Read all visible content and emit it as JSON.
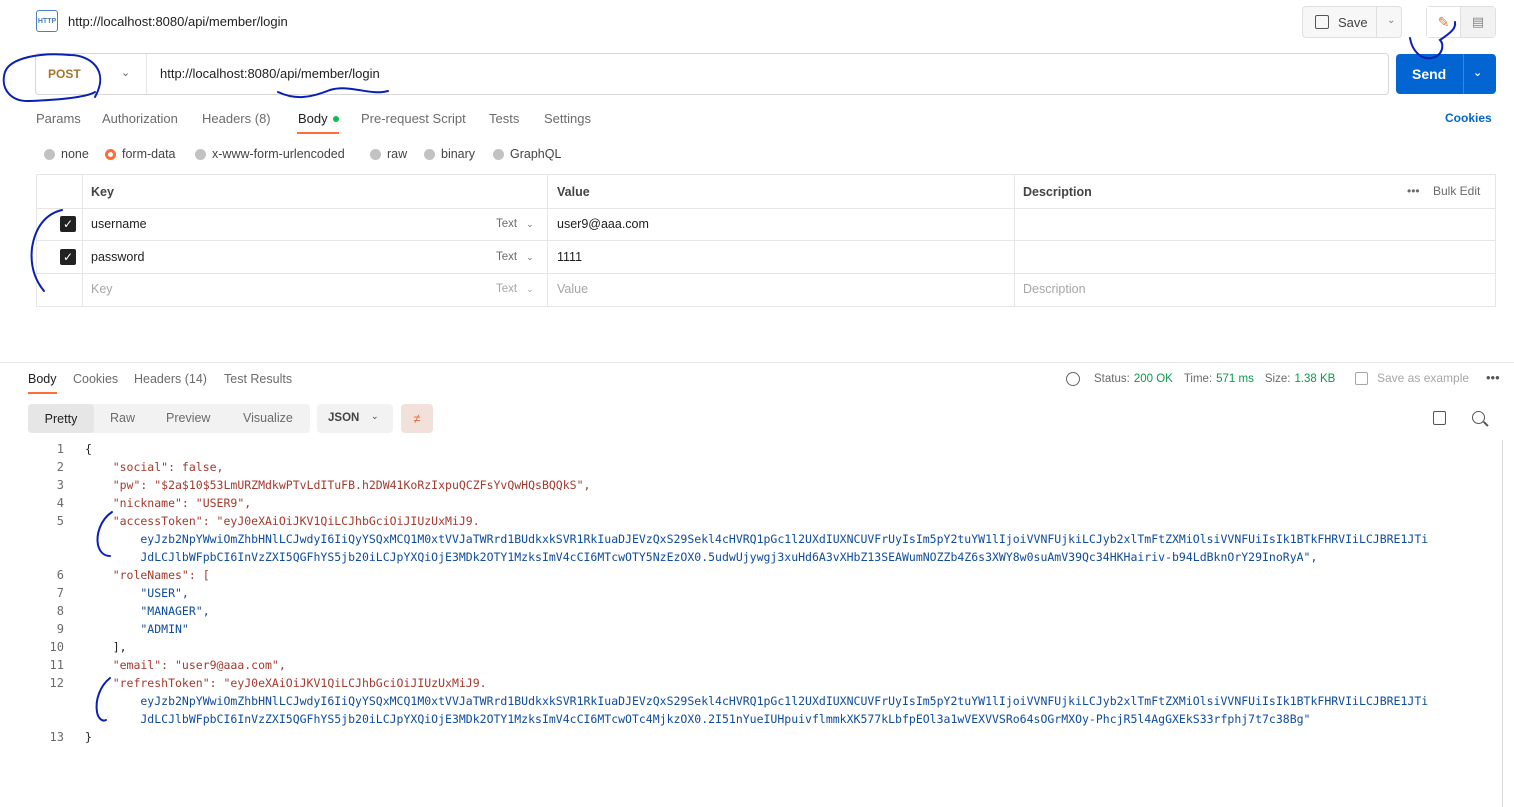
{
  "header": {
    "title": "http://localhost:8080/api/member/login",
    "http_icon_text": "HTTP",
    "save_label": "Save"
  },
  "request": {
    "method": "POST",
    "url": "http://localhost:8080/api/member/login",
    "send_label": "Send"
  },
  "tabs": [
    {
      "label": "Params"
    },
    {
      "label": "Authorization"
    },
    {
      "label": "Headers (8)"
    },
    {
      "label": "Body"
    },
    {
      "label": "Pre-request Script"
    },
    {
      "label": "Tests"
    },
    {
      "label": "Settings"
    }
  ],
  "cookies_label": "Cookies",
  "body_types": [
    {
      "label": "none"
    },
    {
      "label": "form-data"
    },
    {
      "label": "x-www-form-urlencoded"
    },
    {
      "label": "raw"
    },
    {
      "label": "binary"
    },
    {
      "label": "GraphQL"
    }
  ],
  "params_table": {
    "headers": {
      "key": "Key",
      "value": "Value",
      "description": "Description",
      "bulk_edit": "Bulk Edit"
    },
    "rows": [
      {
        "key": "username",
        "type": "Text",
        "value": "user9@aaa.com",
        "description": ""
      },
      {
        "key": "password",
        "type": "Text",
        "value": "1111",
        "description": ""
      }
    ],
    "placeholder": {
      "key": "Key",
      "type": "Text",
      "value": "Value",
      "description": "Description"
    }
  },
  "response": {
    "tabs": [
      {
        "label": "Body"
      },
      {
        "label": "Cookies"
      },
      {
        "label": "Headers (14)"
      },
      {
        "label": "Test Results"
      }
    ],
    "status_label": "Status:",
    "status_value": "200 OK",
    "time_label": "Time:",
    "time_value": "571 ms",
    "size_label": "Size:",
    "size_value": "1.38 KB",
    "save_example": "Save as example",
    "view_modes": [
      {
        "label": "Pretty"
      },
      {
        "label": "Raw"
      },
      {
        "label": "Preview"
      },
      {
        "label": "Visualize"
      }
    ],
    "format": "JSON"
  },
  "code": {
    "line_numbers": [
      "1",
      "2",
      "3",
      "4",
      "5",
      "6",
      "7",
      "8",
      "9",
      "10",
      "11",
      "12",
      "13"
    ],
    "lines": [
      "{",
      "    \"social\": false,",
      "    \"pw\": \"$2a$10$53LmURZMdkwPTvLdITuFB.h2DW41KoRzIxpuQCZFsYvQwHQsBQQkS\",",
      "    \"nickname\": \"USER9\",",
      "    \"accessToken\": \"eyJ0eXAiOiJKV1QiLCJhbGciOiJIUzUxMiJ9.",
      "        eyJzb2NpYWwiOmZhbHNlLCJwdyI6IiQyYSQxMCQ1M0xtVVJaTWRrd1BUdkxkSVR1RkIuaDJEVzQxS29Sekl4cHVRQ1pGc1l2UXdIUXNCUVFrUyIsIm5pY2tuYW1lIjoiVVNFUjkiLCJyb2xlTmFtZXMiOlsiVVNFUiIsIk1BTkFHRVIiLCJBRE1JTi",
      "        JdLCJlbWFpbCI6InVzZXI5QGFhYS5jb20iLCJpYXQiOjE3MDk2OTY1MzksImV4cCI6MTcwOTY5NzEzOX0.5udwUjywgj3xuHd6A3vXHbZ13SEAWumNOZZb4Z6s3XWY8w0suAmV39Qc34HKHairiv-b94LdBknOrY29InoRyA\",",
      "    \"roleNames\": [",
      "        \"USER\",",
      "        \"MANAGER\",",
      "        \"ADMIN\"",
      "    ],",
      "    \"email\": \"user9@aaa.com\",",
      "    \"refreshToken\": \"eyJ0eXAiOiJKV1QiLCJhbGciOiJIUzUxMiJ9.",
      "        eyJzb2NpYWwiOmZhbHNlLCJwdyI6IiQyYSQxMCQ1M0xtVVJaTWRrd1BUdkxkSVR1RkIuaDJEVzQxS29Sekl4cHVRQ1pGc1l2UXdIUXNCUVFrUyIsIm5pY2tuYW1lIjoiVVNFUjkiLCJyb2xlTmFtZXMiOlsiVVNFUiIsIk1BTkFHRVIiLCJBRE1JTi",
      "        JdLCJlbWFpbCI6InVzZXI5QGFhYS5jb20iLCJpYXQiOjE3MDk2OTY1MzksImV4cCI6MTcwOTc4MjkzOX0.2I51nYueIUHpuivflmmkXK577kLbfpEOl3a1wVEXVVSRo64sOGrMXOy-PhcjR5l4AgGXEkS33rfphj7t7c38Bg\"",
      "}"
    ]
  },
  "colors": {
    "accent": "#ff6c37",
    "send": "#0265d2",
    "method": "#a6742c",
    "status_ok": "#0a9a4a",
    "annotation_ink": "#0a1fb5"
  }
}
